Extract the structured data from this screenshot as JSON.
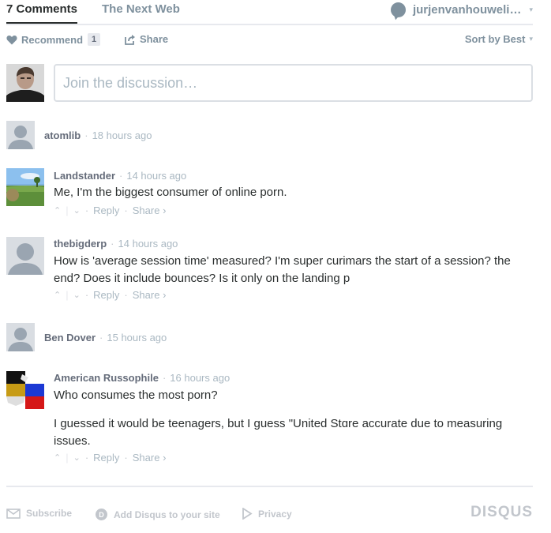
{
  "header": {
    "comments_tab": "7 Comments",
    "site_tab": "The Next Web",
    "username": "jurjenvanhouweli…",
    "caret": "▾"
  },
  "toolbar": {
    "recommend_label": "Recommend",
    "recommend_count": "1",
    "share_label": "Share",
    "sort_label": "Sort by Best",
    "caret": "▾"
  },
  "compose": {
    "placeholder": "Join the discussion…"
  },
  "comments": [
    {
      "author": "atomlib",
      "time": "18 hours ago",
      "dot": "·",
      "avatar": "default-avatar"
    },
    {
      "author": "Landstander",
      "time": "14 hours ago",
      "dot": "·",
      "avatar": "landscape-avatar",
      "paragraphs": [
        "Me, I'm the biggest consumer of online porn."
      ],
      "reply": "Reply",
      "share": "Share ›"
    },
    {
      "author": "thebigderp",
      "time": "14 hours ago",
      "dot": "·",
      "avatar": "default-avatar",
      "lines": [
        "How is 'average session time' measured? I'm super curimars the start of a session? the",
        "end? Does it include bounces? Is it only on the landing p"
      ],
      "reply": "Reply",
      "share": "Share ›"
    },
    {
      "author": "Ben Dover",
      "time": "15 hours ago",
      "dot": "·",
      "avatar": "default-avatar"
    },
    {
      "author": "American Russophile",
      "time": "16 hours ago",
      "dot": "·",
      "avatar": "flag-avatar",
      "paragraphs": [
        "Who consumes the most porn?"
      ],
      "lines2": [
        "I guessed it would be teenagers, but I guess \"United Stɑre accurate due to measuring",
        "issues."
      ],
      "reply": "Reply",
      "share": "Share ›"
    }
  ],
  "vote": {
    "up": "⌃",
    "down": "⌄",
    "bar": "|",
    "dot": "·"
  },
  "footer": {
    "subscribe": "Subscribe",
    "add_disqus": "Add Disqus to your site",
    "privacy": "Privacy",
    "logo": "DISQUS"
  },
  "colors": {
    "text": "#2a2e2e",
    "muted": "#7f919e",
    "light": "#aab8c2",
    "border": "#dbdfe4"
  }
}
